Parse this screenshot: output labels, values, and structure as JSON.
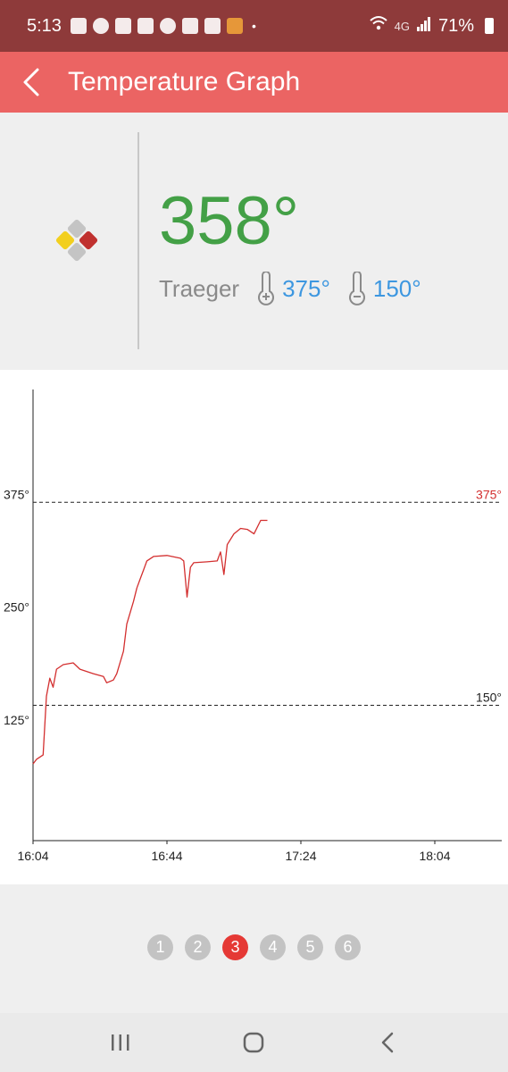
{
  "status_bar": {
    "time": "5:13",
    "network": "4G",
    "battery": "71%",
    "dot": "•"
  },
  "app_bar": {
    "title": "Temperature Graph"
  },
  "probe": {
    "current_temp": "358°",
    "name": "Traeger",
    "high_target": "375°",
    "low_target": "150°"
  },
  "colors": {
    "accent": "#eb6463",
    "status_bar": "#8e3a3a",
    "temp_green": "#43a046",
    "target_blue": "#3d97e0",
    "line_red": "#d32f2f",
    "page_active": "#e53935"
  },
  "chart_data": {
    "type": "line",
    "x_ticks": [
      "16:04",
      "16:44",
      "17:24",
      "18:04"
    ],
    "x_range": [
      "16:04",
      "18:24"
    ],
    "y_ticks": [
      "125°",
      "250°",
      "375°"
    ],
    "y_ticks_values": [
      125,
      250,
      375
    ],
    "ylim": [
      0,
      500
    ],
    "high_limit": {
      "value": 375,
      "label": "375°"
    },
    "low_limit": {
      "value": 150,
      "label": "150°"
    },
    "series": [
      {
        "points": [
          [
            "16:04",
            85
          ],
          [
            "16:05",
            90
          ],
          [
            "16:07",
            95
          ],
          [
            "16:08",
            160
          ],
          [
            "16:09",
            180
          ],
          [
            "16:10",
            170
          ],
          [
            "16:11",
            190
          ],
          [
            "16:13",
            195
          ],
          [
            "16:16",
            197
          ],
          [
            "16:18",
            190
          ],
          [
            "16:22",
            185
          ],
          [
            "16:25",
            182
          ],
          [
            "16:26",
            175
          ],
          [
            "16:28",
            178
          ],
          [
            "16:29",
            185
          ],
          [
            "16:31",
            210
          ],
          [
            "16:32",
            240
          ],
          [
            "16:34",
            265
          ],
          [
            "16:35",
            280
          ],
          [
            "16:36",
            290
          ],
          [
            "16:37",
            300
          ],
          [
            "16:38",
            310
          ],
          [
            "16:40",
            315
          ],
          [
            "16:44",
            316
          ],
          [
            "16:48",
            313
          ],
          [
            "16:49",
            310
          ],
          [
            "16:50",
            270
          ],
          [
            "16:51",
            303
          ],
          [
            "16:52",
            308
          ],
          [
            "16:56",
            309
          ],
          [
            "16:59",
            310
          ],
          [
            "17:00",
            320
          ],
          [
            "17:01",
            295
          ],
          [
            "17:02",
            328
          ],
          [
            "17:04",
            340
          ],
          [
            "17:06",
            346
          ],
          [
            "17:08",
            345
          ],
          [
            "17:10",
            340
          ],
          [
            "17:12",
            355
          ],
          [
            "17:14",
            355
          ]
        ]
      }
    ]
  },
  "pager": {
    "pages": [
      "1",
      "2",
      "3",
      "4",
      "5",
      "6"
    ],
    "active_index": 2
  }
}
